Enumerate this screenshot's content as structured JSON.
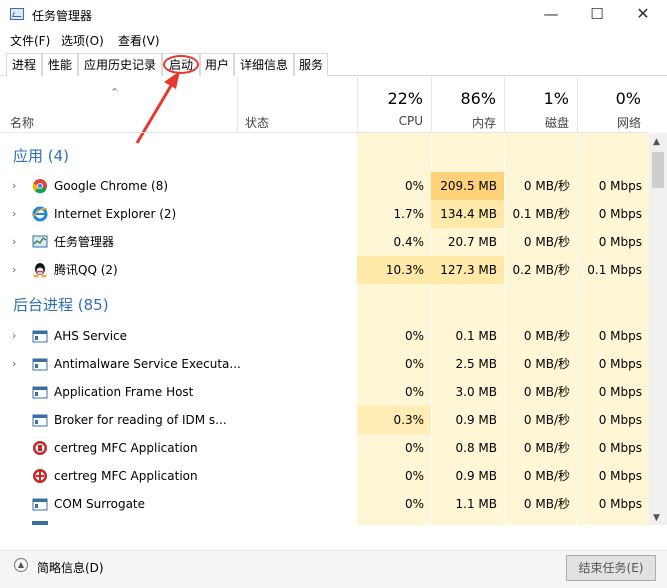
{
  "window": {
    "title": "任务管理器",
    "min_glyph": "—",
    "max_glyph": "☐",
    "close_glyph": "✕"
  },
  "menu": [
    "文件(F)",
    "选项(O)",
    "查看(V)"
  ],
  "tabs": [
    {
      "label": "进程",
      "active": true
    },
    {
      "label": "性能"
    },
    {
      "label": "应用历史记录"
    },
    {
      "label": "启动"
    },
    {
      "label": "用户"
    },
    {
      "label": "详细信息"
    },
    {
      "label": "服务"
    }
  ],
  "header": {
    "name": "名称",
    "status": "状态",
    "cpu": {
      "pct": "22%",
      "label": "CPU"
    },
    "memory": {
      "pct": "86%",
      "label": "内存"
    },
    "disk": {
      "pct": "1%",
      "label": "磁盘"
    },
    "network": {
      "pct": "0%",
      "label": "网络"
    },
    "sort_glyph": "⌃"
  },
  "groups": {
    "apps": "应用 (4)",
    "background": "后台进程 (85)"
  },
  "processes": [
    {
      "name": "Google Chrome (8)",
      "icon": "chrome-icon",
      "cpu": "0%",
      "mem": "209.5 MB",
      "disk": "0 MB/秒",
      "net": "0 Mbps",
      "expand": true
    },
    {
      "name": "Internet Explorer (2)",
      "icon": "ie-icon",
      "cpu": "1.7%",
      "mem": "134.4 MB",
      "disk": "0.1 MB/秒",
      "net": "0 Mbps",
      "expand": true
    },
    {
      "name": "任务管理器",
      "icon": "task-manager-icon",
      "cpu": "0.4%",
      "mem": "20.7 MB",
      "disk": "0 MB/秒",
      "net": "0 Mbps",
      "expand": true
    },
    {
      "name": "腾讯QQ (2)",
      "icon": "qq-icon",
      "cpu": "10.3%",
      "mem": "127.3 MB",
      "disk": "0.2 MB/秒",
      "net": "0.1 Mbps",
      "expand": true
    },
    {
      "name": "AHS Service",
      "icon": "service-icon",
      "cpu": "0%",
      "mem": "0.1 MB",
      "disk": "0 MB/秒",
      "net": "0 Mbps",
      "expand": true
    },
    {
      "name": "Antimalware Service Executa...",
      "icon": "service-icon",
      "cpu": "0%",
      "mem": "2.5 MB",
      "disk": "0 MB/秒",
      "net": "0 Mbps",
      "expand": true
    },
    {
      "name": "Application Frame Host",
      "icon": "service-icon",
      "cpu": "0%",
      "mem": "3.0 MB",
      "disk": "0 MB/秒",
      "net": "0 Mbps",
      "expand": false
    },
    {
      "name": "Broker for reading of IDM s...",
      "icon": "service-icon",
      "cpu": "0.3%",
      "mem": "0.9 MB",
      "disk": "0 MB/秒",
      "net": "0 Mbps",
      "expand": false
    },
    {
      "name": "certreg MFC Application",
      "icon": "certreg-icon",
      "cpu": "0%",
      "mem": "0.8 MB",
      "disk": "0 MB/秒",
      "net": "0 Mbps",
      "expand": false
    },
    {
      "name": "certreg MFC Application",
      "icon": "certreg-icon",
      "cpu": "0%",
      "mem": "0.9 MB",
      "disk": "0 MB/秒",
      "net": "0 Mbps",
      "expand": false
    },
    {
      "name": "COM Surrogate",
      "icon": "service-icon",
      "cpu": "0%",
      "mem": "1.1 MB",
      "disk": "0 MB/秒",
      "net": "0 Mbps",
      "expand": false
    }
  ],
  "footer": {
    "less_details": "简略信息(D)",
    "end_task": "结束任务(E)"
  },
  "colors": {
    "group_title": "#2f6fb7",
    "metric_bg": "#fff6d6",
    "mem_heat_high": "#ffd27a",
    "annotation": "#e8382e"
  }
}
